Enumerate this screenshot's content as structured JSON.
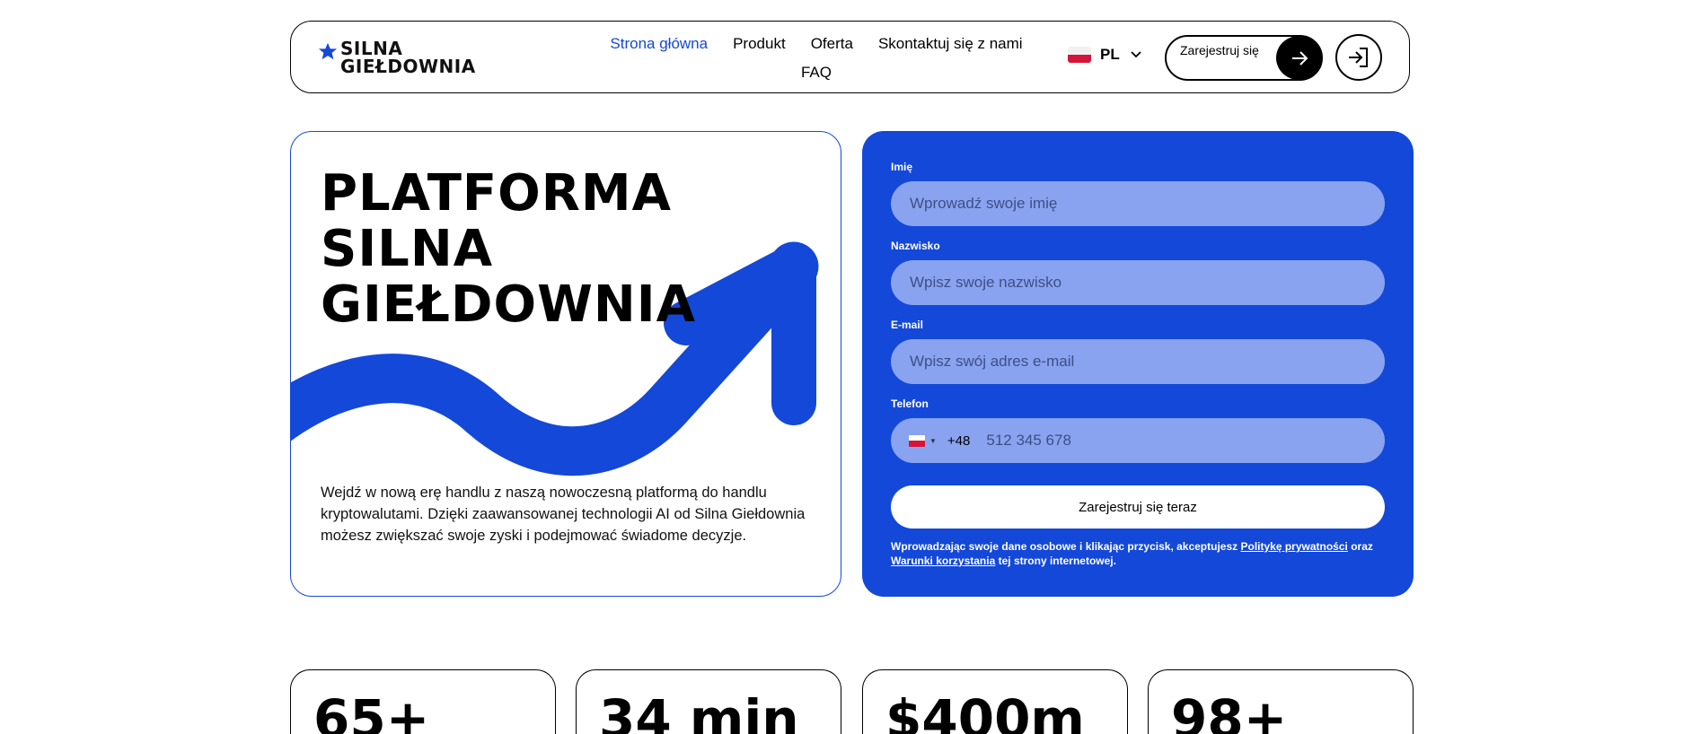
{
  "brand": {
    "logo_line1": "SILNA",
    "logo_line2": "GIEŁDOWNIA",
    "accent_color": "#1448d8"
  },
  "nav": {
    "items": [
      {
        "label": "Strona główna",
        "active": true
      },
      {
        "label": "Produkt"
      },
      {
        "label": "Oferta"
      },
      {
        "label": "Skontaktuj się z nami"
      },
      {
        "label": "FAQ"
      }
    ]
  },
  "language": {
    "code": "PL",
    "flag_icon": "poland-flag-icon"
  },
  "header": {
    "register_label": "Zarejestruj się",
    "login_icon": "login-icon"
  },
  "hero": {
    "title_lines": [
      "PLATFORMA",
      "SILNA",
      "GIEŁDOWNIA"
    ],
    "description": "Wejdź w nową erę handlu z naszą nowoczesną platformą do handlu kryptowalutami. Dzięki zaawansowanej technologii AI od Silna Giełdownia możesz zwiększać swoje zyski i podejmować świadome decyzje."
  },
  "form": {
    "first_name_label": "Imię",
    "first_name_placeholder": "Wprowadź swoje imię",
    "last_name_label": "Nazwisko",
    "last_name_placeholder": "Wpisz swoje nazwisko",
    "email_label": "E-mail",
    "email_placeholder": "Wpisz swój adres e-mail",
    "phone_label": "Telefon",
    "phone_code": "+48",
    "phone_placeholder": "512 345 678",
    "submit_label": "Zarejestruj się teraz",
    "consent_prefix": "Wprowadzając swoje dane osobowe i klikając przycisk, akceptujesz ",
    "privacy_link": "Politykę prywatności",
    "consent_mid": " oraz ",
    "terms_link": "Warunki korzystania",
    "consent_suffix": " tej strony internetowej."
  },
  "stats": [
    "65+",
    "34 min",
    "$400m",
    "98+"
  ]
}
